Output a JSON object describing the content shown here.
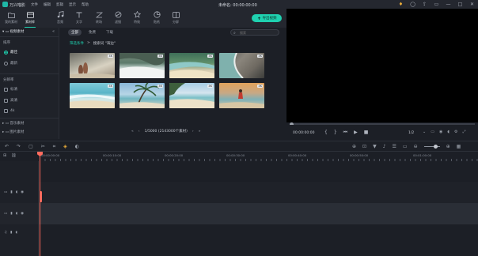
{
  "titlebar": {
    "app_name": "万兴喵影",
    "menu": [
      "文件",
      "编辑",
      "剪辑",
      "显示",
      "帮助"
    ],
    "project_title": "未命名: 00:00:00:00"
  },
  "toolbar": {
    "items": [
      {
        "label": "我的素材",
        "icon": "folder-icon"
      },
      {
        "label": "素材库",
        "icon": "library-icon"
      },
      {
        "label": "音频",
        "icon": "music-icon"
      },
      {
        "label": "文字",
        "icon": "text-icon"
      },
      {
        "label": "转场",
        "icon": "transition-icon"
      },
      {
        "label": "滤镜",
        "icon": "filter-icon"
      },
      {
        "label": "特效",
        "icon": "effects-icon"
      },
      {
        "label": "贴纸",
        "icon": "sticker-icon"
      },
      {
        "label": "分屏",
        "icon": "splitscreen-icon"
      }
    ],
    "export_label": "导出视频"
  },
  "sidebar": {
    "header": "视频素材",
    "section_sort": "排序",
    "sort_options": [
      "最佳",
      "最新"
    ],
    "section_resolution": "分辨率",
    "resolution_options": [
      "标清",
      "高清",
      "4k"
    ],
    "folders": [
      "音乐素材",
      "图片素材"
    ]
  },
  "content": {
    "tabs": [
      "全部",
      "免费",
      "下载"
    ],
    "search_placeholder": "搜索",
    "filter_link": "筛选条件",
    "filter_text": "搜索词 \"海边\"",
    "badge": "4K",
    "pager": {
      "page": "1/5000 (2143000个素材)"
    }
  },
  "preview": {
    "time": "00:00:00:00",
    "ratio": "1/2"
  },
  "timeline": {
    "ruler_labels": [
      "00:00:00:00",
      "00:00:10:00",
      "00:00:20:00",
      "00:00:30:00",
      "00:00:40:00",
      "00:00:50:00",
      "00:01:00:00"
    ]
  },
  "colors": {
    "accent": "#1fd1b0",
    "playhead": "#ff6b5e",
    "background": "#1c1f26"
  }
}
